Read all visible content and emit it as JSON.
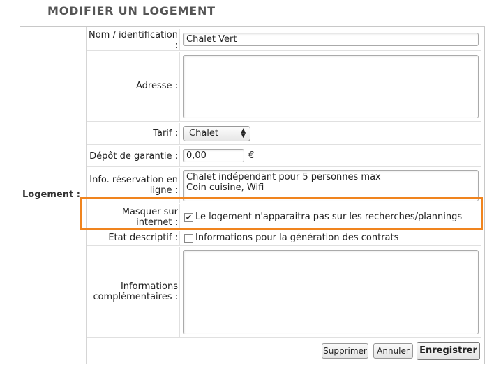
{
  "page": {
    "title": "MODIFIER UN LOGEMENT"
  },
  "section": {
    "label": "Logement :"
  },
  "fields": {
    "nom": {
      "label": "Nom / identification :",
      "value": "Chalet Vert"
    },
    "adresse": {
      "label": "Adresse :",
      "value": ""
    },
    "tarif": {
      "label": "Tarif :",
      "value": "Chalet"
    },
    "depot": {
      "label": "Dépôt de garantie :",
      "value": "0,00",
      "unit": "€"
    },
    "info_reservation": {
      "label": "Info. réservation en ligne :",
      "value": "Chalet indépendant pour 5 personnes max\nCoin cuisine, Wifi"
    },
    "masquer": {
      "label": "Masquer sur internet :",
      "checked": true,
      "text": "Le logement n'apparaitra pas sur les recherches/plannings"
    },
    "etat": {
      "label": "Etat descriptif :",
      "checked": false,
      "text": "Informations pour la génération des contrats"
    },
    "infos_comp": {
      "label": "Informations complémentaires :",
      "value": ""
    }
  },
  "buttons": {
    "supprimer": "Supprimer",
    "annuler": "Annuler",
    "enregistrer": "Enregistrer"
  },
  "highlight_color": "#f0841e"
}
